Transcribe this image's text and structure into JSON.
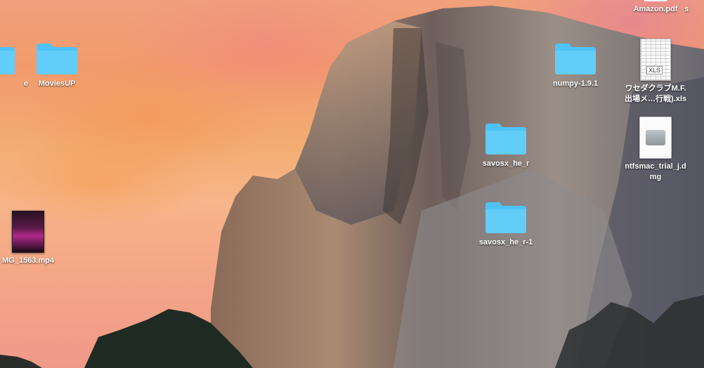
{
  "desktop": {
    "icons": [
      {
        "type": "folder",
        "label": "e",
        "icon": "folder-icon"
      },
      {
        "type": "folder",
        "label": "MoviesUP",
        "icon": "folder-icon"
      },
      {
        "type": "video",
        "label": "MG_1563.mp4",
        "icon": "video-file-icon"
      },
      {
        "type": "pdf",
        "label": "Amazon.pdf",
        "icon": "pdf-file-icon"
      },
      {
        "type": "other",
        "label": "s",
        "icon": "file-icon"
      },
      {
        "type": "folder",
        "label": "numpy-1.9.1",
        "icon": "folder-icon"
      },
      {
        "type": "xls",
        "label": "ワセダクラブM.F.\n出場メ…行戦).xls",
        "icon": "spreadsheet-file-icon"
      },
      {
        "type": "folder",
        "label": "savosx_he_r",
        "icon": "folder-icon"
      },
      {
        "type": "dmg",
        "label": "ntfsmac_trial_j.d\nmg",
        "icon": "disk-image-icon"
      },
      {
        "type": "folder",
        "label": "savosx_he_r-1",
        "icon": "folder-icon"
      }
    ],
    "folder_color": "#4fc3f7",
    "label_color": "#ffffff"
  }
}
